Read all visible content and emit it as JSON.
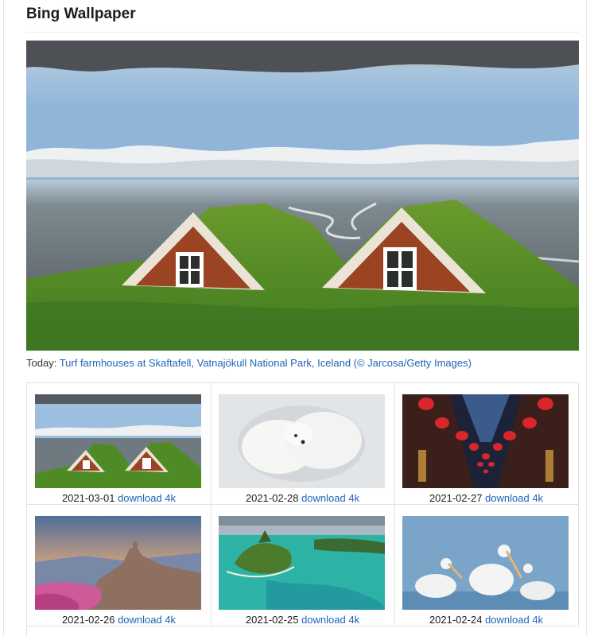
{
  "page": {
    "title": "Bing Wallpaper"
  },
  "today": {
    "prefix": "Today:",
    "link_text": "Turf farmhouses at Skaftafell, Vatnajökull National Park, Iceland (© Jarcosa/Getty Images)",
    "image_subject": "turf farmhouses with grass roofs under cloudy sky"
  },
  "wallpapers": [
    {
      "date": "2021-03-01",
      "download_label": "download 4k",
      "subject": "turf farmhouses"
    },
    {
      "date": "2021-02-28",
      "download_label": "download 4k",
      "subject": "sleeping polar bears"
    },
    {
      "date": "2021-02-27",
      "download_label": "download 4k",
      "subject": "red lanterns"
    },
    {
      "date": "2021-02-26",
      "download_label": "download 4k",
      "subject": "hilltop village with blossoms"
    },
    {
      "date": "2021-02-25",
      "download_label": "download 4k",
      "subject": "tropical island lagoon"
    },
    {
      "date": "2021-02-24",
      "download_label": "download 4k",
      "subject": "pelicans"
    }
  ],
  "colors": {
    "link": "#1f63b5",
    "border": "#dee2e6",
    "title": "#1d1d1d"
  }
}
